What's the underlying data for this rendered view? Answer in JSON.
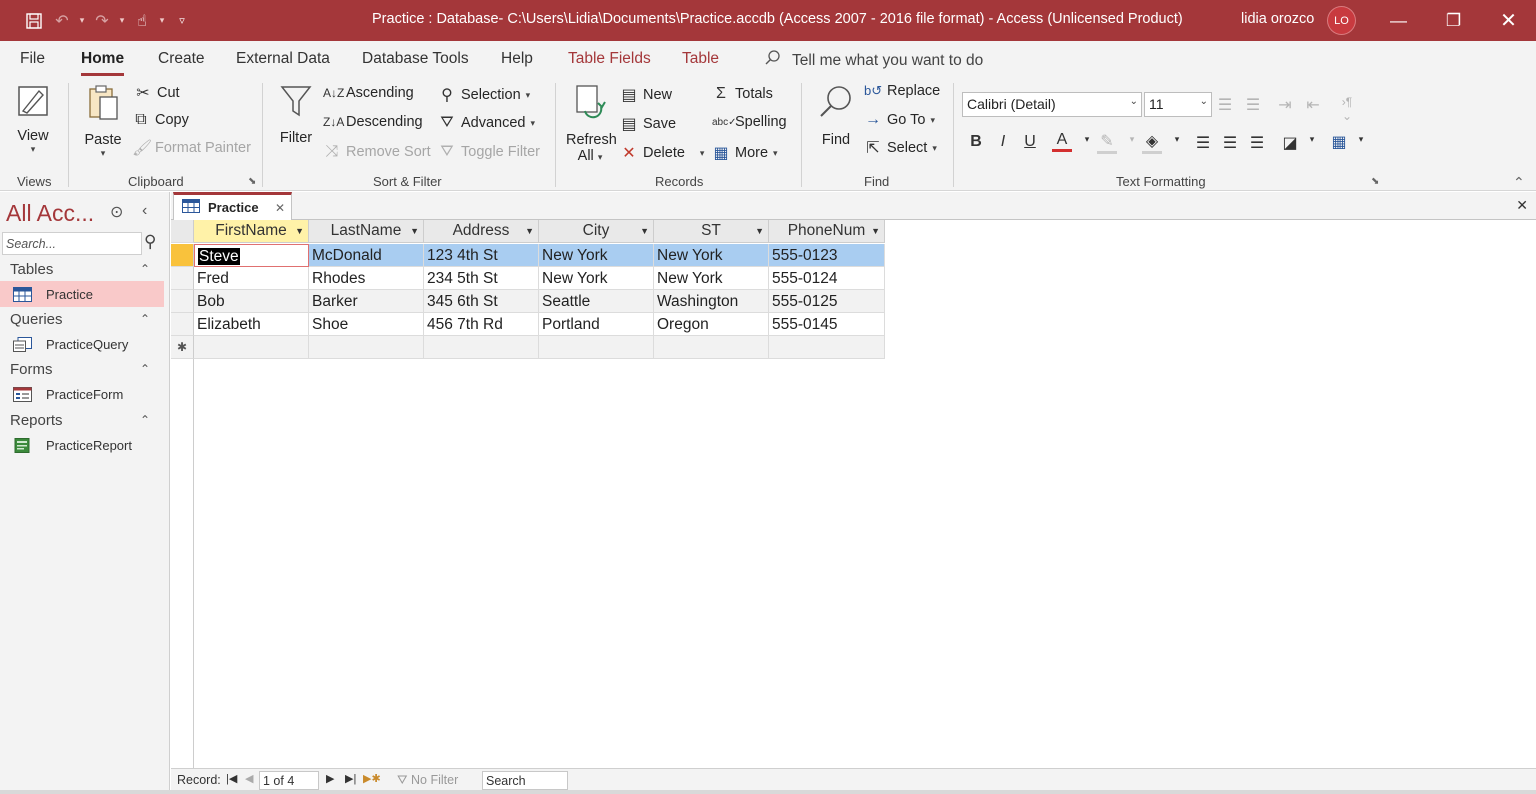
{
  "titlebar": {
    "title": "Practice : Database- C:\\Users\\Lidia\\Documents\\Practice.accdb (Access 2007 - 2016 file format)  -  Access (Unlicensed Product)",
    "user": "lidia orozco",
    "initials": "LO"
  },
  "tabs": {
    "file": "File",
    "home": "Home",
    "create": "Create",
    "external": "External Data",
    "dbtools": "Database Tools",
    "help": "Help",
    "tablefields": "Table Fields",
    "table": "Table",
    "tellme": "Tell me what you want to do"
  },
  "ribbon": {
    "views": {
      "label": "Views",
      "view": "View"
    },
    "clipboard": {
      "label": "Clipboard",
      "paste": "Paste",
      "cut": "Cut",
      "copy": "Copy",
      "format_painter": "Format Painter"
    },
    "sortfilter": {
      "label": "Sort & Filter",
      "filter": "Filter",
      "ascending": "Ascending",
      "descending": "Descending",
      "remove_sort": "Remove Sort",
      "selection": "Selection",
      "advanced": "Advanced",
      "toggle_filter": "Toggle Filter"
    },
    "records": {
      "label": "Records",
      "refresh": "Refresh",
      "refresh_all": "All",
      "new": "New",
      "save": "Save",
      "delete": "Delete",
      "totals": "Totals",
      "spelling": "Spelling",
      "more": "More"
    },
    "find": {
      "label": "Find",
      "find": "Find",
      "replace": "Replace",
      "goto": "Go To",
      "select": "Select"
    },
    "text": {
      "label": "Text Formatting",
      "font": "Calibri (Detail)",
      "size": "11"
    }
  },
  "nav": {
    "title": "All Acc...",
    "search_placeholder": "Search...",
    "groups": [
      {
        "name": "Tables",
        "items": [
          "Practice"
        ]
      },
      {
        "name": "Queries",
        "items": [
          "PracticeQuery"
        ]
      },
      {
        "name": "Forms",
        "items": [
          "PracticeForm"
        ]
      },
      {
        "name": "Reports",
        "items": [
          "PracticeReport"
        ]
      }
    ]
  },
  "doc": {
    "tab": "Practice"
  },
  "table": {
    "columns": [
      "FirstName",
      "LastName",
      "Address",
      "City",
      "ST",
      "PhoneNum"
    ],
    "rows": [
      [
        "Steve",
        "McDonald",
        "123 4th St",
        "New York",
        "New York",
        "555-0123"
      ],
      [
        "Fred",
        "Rhodes",
        "234 5th St",
        "New York",
        "New York",
        "555-0124"
      ],
      [
        "Bob",
        "Barker",
        "345 6th St",
        "Seattle",
        "Washington",
        "555-0125"
      ],
      [
        "Elizabeth",
        "Shoe",
        "456 7th Rd",
        "Portland",
        "Oregon",
        "555-0145"
      ]
    ],
    "new_row_marker": "✱"
  },
  "recordnav": {
    "label": "Record:",
    "position": "1 of 4",
    "filter": "No Filter",
    "search": "Search"
  }
}
